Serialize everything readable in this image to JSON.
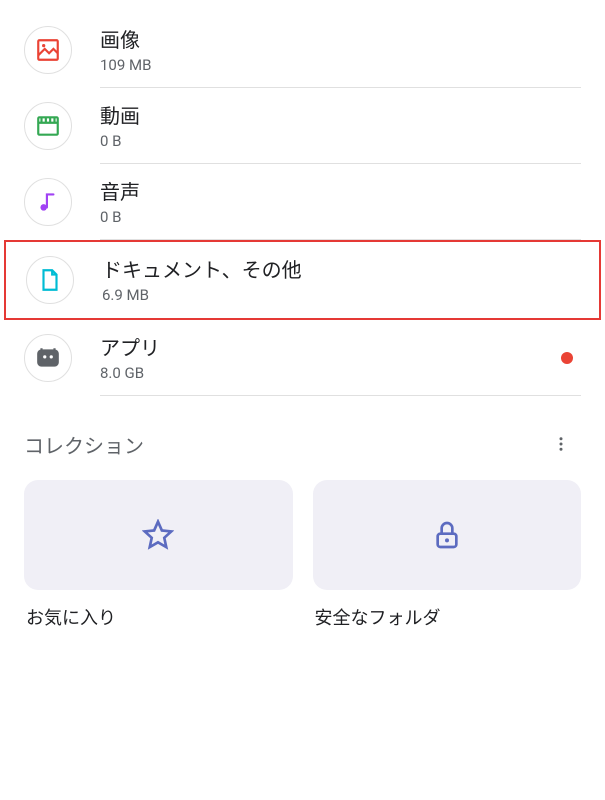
{
  "categories": [
    {
      "title": "画像",
      "size": "109 MB",
      "icon": "image-icon",
      "color": "#ea4335"
    },
    {
      "title": "動画",
      "size": "0 B",
      "icon": "video-icon",
      "color": "#34a853"
    },
    {
      "title": "音声",
      "size": "0 B",
      "icon": "audio-icon",
      "color": "#a142f4"
    },
    {
      "title": "ドキュメント、その他",
      "size": "6.9 MB",
      "icon": "document-icon",
      "color": "#00bcd4",
      "highlighted": true
    },
    {
      "title": "アプリ",
      "size": "8.0 GB",
      "icon": "app-icon",
      "color": "#5f6368",
      "indicator": true
    }
  ],
  "section": {
    "title": "コレクション"
  },
  "collections": [
    {
      "label": "お気に入り",
      "icon": "star-icon"
    },
    {
      "label": "安全なフォルダ",
      "icon": "lock-icon"
    }
  ]
}
